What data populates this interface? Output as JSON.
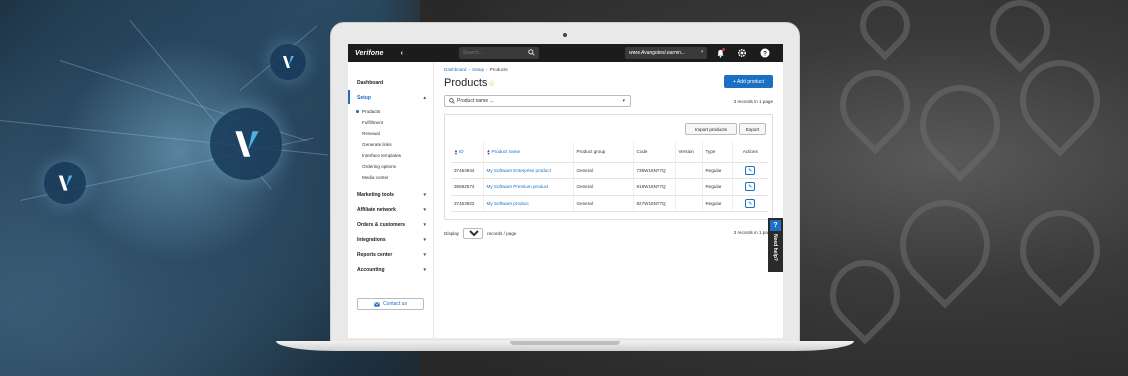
{
  "background": {
    "left_color": "#1e3446",
    "right_color": "#3a3a3a"
  },
  "header": {
    "logo": "Verifone",
    "search_placeholder": "Search...",
    "account": "www.Avangotesl.earnin...",
    "icons": [
      "chevron-left-icon",
      "search-icon",
      "bell-icon",
      "gear-icon",
      "help-icon"
    ]
  },
  "sidebar": {
    "dashboard": "Dashboard",
    "setup": "Setup",
    "setup_items": [
      "Products",
      "Fulfillment",
      "Renewal",
      "Generate links",
      "Interface templates",
      "Ordering options",
      "Media center"
    ],
    "sections": [
      "Marketing tools",
      "Affiliate network",
      "Orders & customers",
      "Integrations",
      "Reports center",
      "Accounting"
    ],
    "contact": "Contact us"
  },
  "breadcrumb": {
    "items": [
      "Dashboard",
      "Setup",
      "Products"
    ],
    "separator": "›"
  },
  "page": {
    "title": "Products",
    "add_button": "+ Add product",
    "filter_placeholder": "Product name ...",
    "records_top": "3 records in 1 page",
    "import_button": "Import products",
    "export_button": "Export"
  },
  "table": {
    "headers": [
      "ID",
      "Product name",
      "Product group",
      "Code",
      "Version",
      "Type",
      "Actions"
    ],
    "rows": [
      {
        "id": "37453944",
        "name": "My Software Enterprise product",
        "group": "General",
        "code": "736W15N77Q",
        "version": "",
        "type": "Regular"
      },
      {
        "id": "36592574",
        "name": "My Software Premium product",
        "group": "General",
        "code": "918W15N77Q",
        "version": "",
        "type": "Regular"
      },
      {
        "id": "37453922",
        "name": "My Software product",
        "group": "General",
        "code": "827W15N77Q",
        "version": "",
        "type": "Regular"
      }
    ]
  },
  "pager": {
    "display": "Display",
    "page_size": "10",
    "suffix": "records / page",
    "records_bottom": "3 records in 1 page"
  },
  "help": {
    "q": "?",
    "label": "Need help?"
  },
  "colors": {
    "accent": "#1b6fc4",
    "topbar": "#1c1c1c",
    "star": "#d9a21b"
  }
}
